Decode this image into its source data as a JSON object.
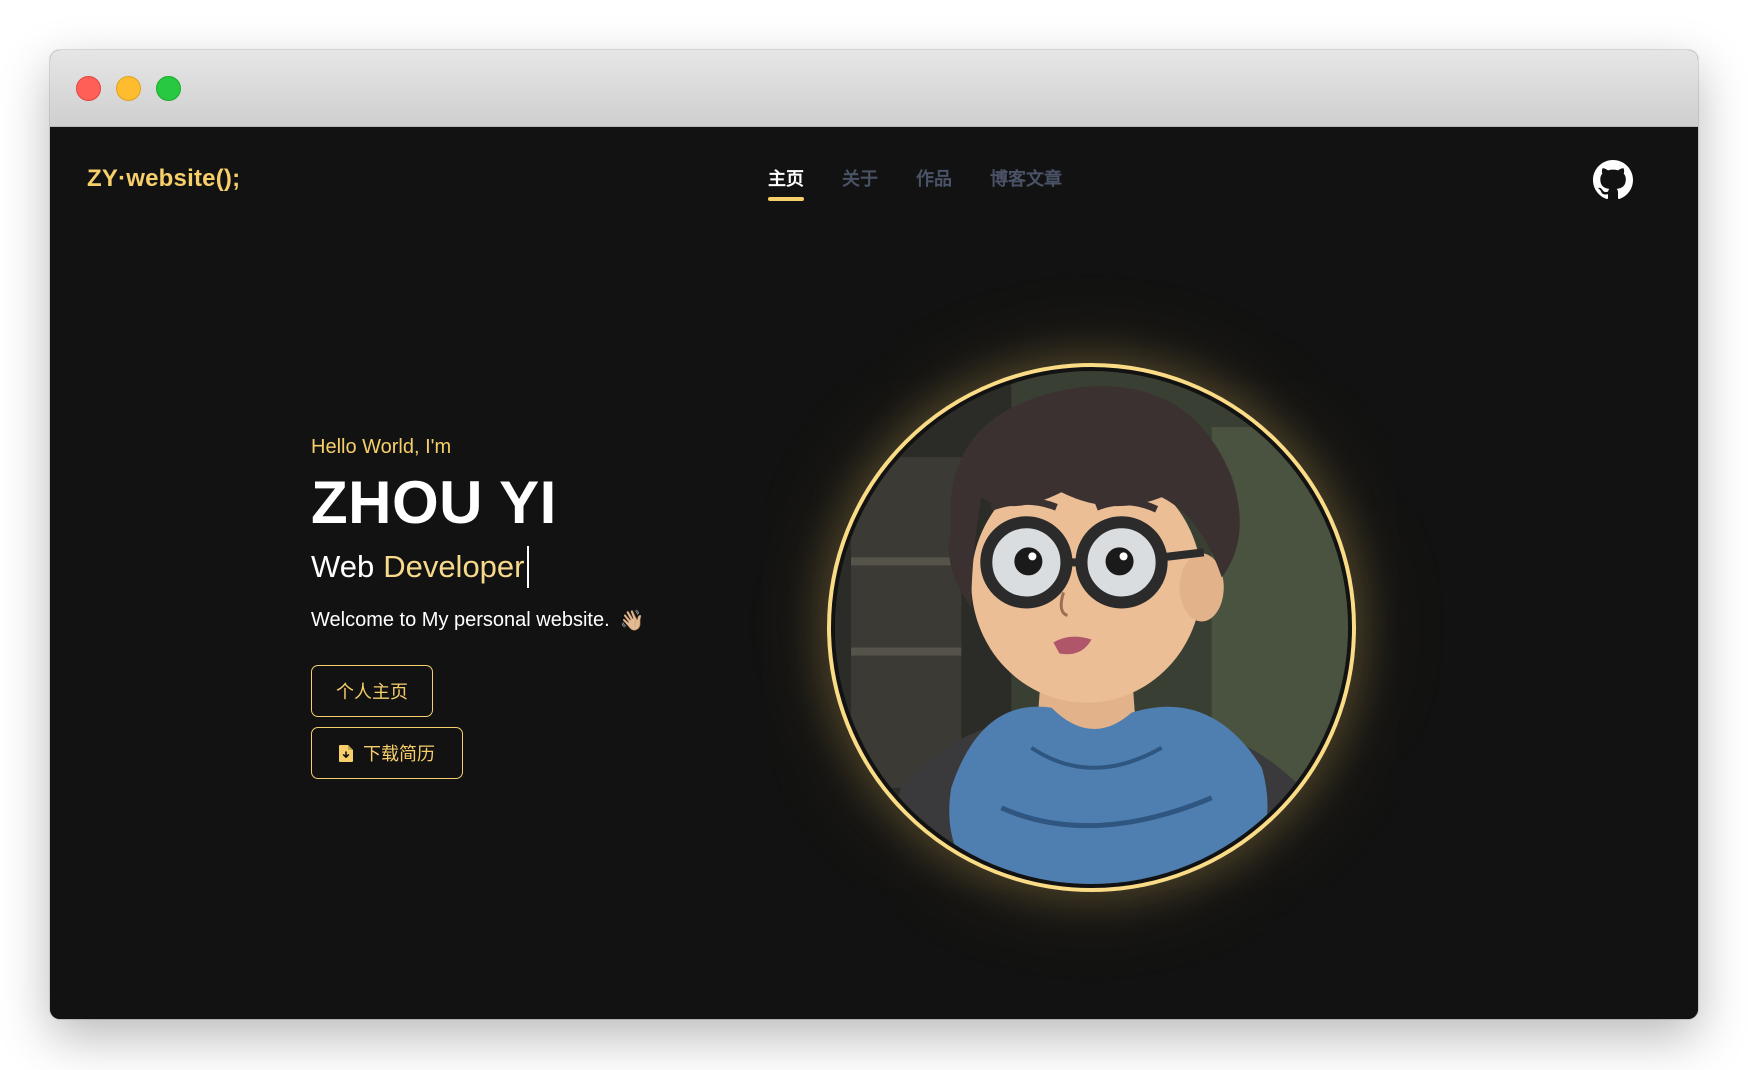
{
  "window": {
    "controls": [
      "close",
      "minimize",
      "zoom"
    ]
  },
  "site": {
    "logo": "ZY·website();"
  },
  "nav": {
    "items": [
      {
        "label": "主页",
        "active": true
      },
      {
        "label": "关于",
        "active": false
      },
      {
        "label": "作品",
        "active": false
      },
      {
        "label": "博客文章",
        "active": false
      }
    ]
  },
  "header": {
    "github_icon": "github-icon"
  },
  "hero": {
    "greeting": "Hello World, I'm",
    "name": "ZHOU YI",
    "role_word1": "Web",
    "role_word2": "Developer",
    "welcome": "Welcome to My personal website.",
    "wave_emoji": "👋🏼",
    "buttons": {
      "home": "个人主页",
      "resume": "下载简历"
    },
    "avatar_icon": "anime-boy-avatar"
  },
  "colors": {
    "accent": "#f6cf6b",
    "background": "#121212",
    "nav_inactive": "#4a5266",
    "text": "#ffffff"
  }
}
